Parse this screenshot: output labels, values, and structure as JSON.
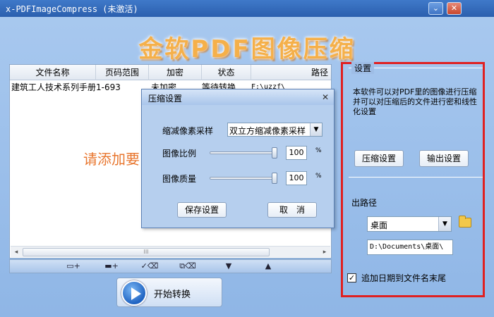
{
  "window": {
    "title": "x-PDFImageCompress (未激活)",
    "min_glyph": "⌄",
    "close_glyph": "✕"
  },
  "banner": {
    "text": "金软PDF图像压缩"
  },
  "table": {
    "columns": [
      "文件名称",
      "页码范围",
      "加密",
      "状态",
      "路径"
    ],
    "rows": [
      {
        "name": "建筑工人技术系列手册1-693",
        "pages": "",
        "encrypt": "未加密",
        "status": "等待转换",
        "path": "F:\\uzzf\\"
      }
    ],
    "empty_hint": "请添加要",
    "scroll_thumb": "III"
  },
  "toolbar": {
    "icons": [
      "add-file-icon",
      "add-folder-icon",
      "remove-selected-icon",
      "clear-all-icon",
      "move-down-icon",
      "move-up-icon"
    ]
  },
  "start_button": {
    "label": "开始转换"
  },
  "settings": {
    "group_title": "设置",
    "description": "本软件可以对PDF里的图像进行压缩并可以对压缩后的文件进行密和线性化设置",
    "compress_settings_label": "压缩设置",
    "output_settings_label": "输出设置",
    "output_path_label": "出路径",
    "output_location": "桌面",
    "output_path": "D:\\Documents\\桌面\\",
    "append_date_label": "追加日期到文件名末尾",
    "append_date_checked": true,
    "accent_color": "#e02020"
  },
  "dialog": {
    "title": "压缩设置",
    "close_glyph": "✕",
    "resample_label": "缩减像素采样",
    "resample_value": "双立方缩减像素采样",
    "scale_label": "图像比例",
    "scale_value": "100",
    "scale_level": 1.0,
    "quality_label": "图像质量",
    "quality_value": "100",
    "quality_level": 1.0,
    "percent_sign": "%",
    "save_label": "保存设置",
    "cancel_label": "取　消"
  }
}
